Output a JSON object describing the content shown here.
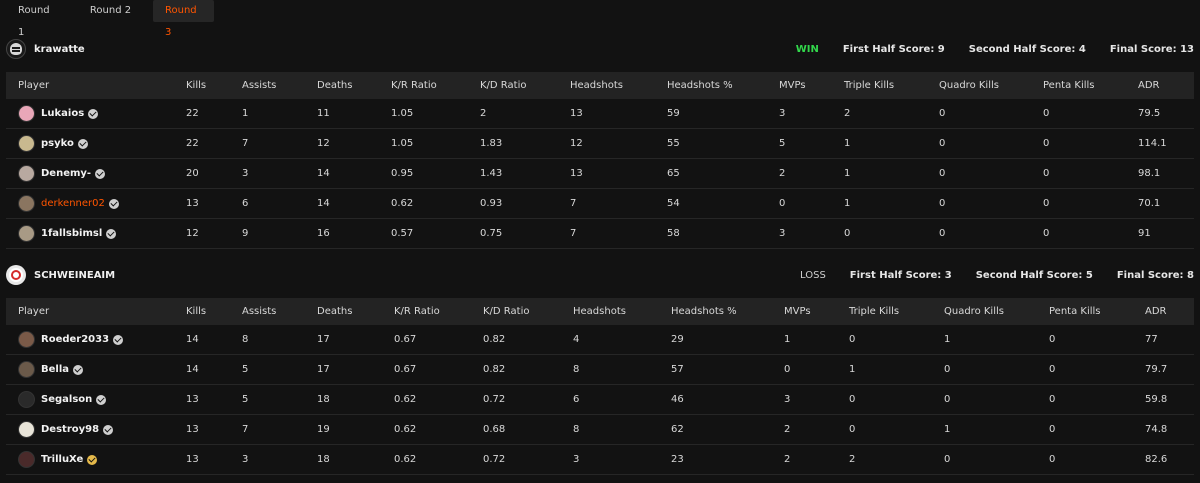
{
  "tabs": [
    {
      "label": "Round 1",
      "active": false
    },
    {
      "label": "Round 2",
      "active": false
    },
    {
      "label": "Round 3",
      "active": true
    }
  ],
  "columns": [
    "Player",
    "Kills",
    "Assists",
    "Deaths",
    "K/R Ratio",
    "K/D Ratio",
    "Headshots",
    "Headshots %",
    "MVPs",
    "Triple Kills",
    "Quadro Kills",
    "Penta Kills",
    "ADR"
  ],
  "teams": [
    {
      "name": "krawatte",
      "result": "WIN",
      "first_half": "First Half Score: 9",
      "second_half": "Second Half Score: 4",
      "final": "Final Score: 13",
      "players": [
        {
          "name": "Lukaios",
          "avatar_color": "#e9a7b8",
          "stats": [
            "22",
            "1",
            "11",
            "1.05",
            "2",
            "13",
            "59",
            "3",
            "2",
            "0",
            "0",
            "79.5"
          ]
        },
        {
          "name": "psyko",
          "avatar_color": "#c9b98f",
          "stats": [
            "22",
            "7",
            "12",
            "1.05",
            "1.83",
            "12",
            "55",
            "5",
            "1",
            "0",
            "0",
            "114.1"
          ]
        },
        {
          "name": "Denemy-",
          "avatar_color": "#b8a9a0",
          "stats": [
            "20",
            "3",
            "14",
            "0.95",
            "1.43",
            "13",
            "65",
            "2",
            "1",
            "0",
            "0",
            "98.1"
          ]
        },
        {
          "name": "derkenner02",
          "avatar_color": "#8a7560",
          "stats": [
            "13",
            "6",
            "14",
            "0.62",
            "0.93",
            "7",
            "54",
            "0",
            "1",
            "0",
            "0",
            "70.1"
          ]
        },
        {
          "name": "1fallsbimsl",
          "avatar_color": "#a89a85",
          "stats": [
            "12",
            "9",
            "16",
            "0.57",
            "0.75",
            "7",
            "58",
            "3",
            "0",
            "0",
            "0",
            "91"
          ]
        }
      ]
    },
    {
      "name": "SCHWEINEAIM",
      "result": "LOSS",
      "first_half": "First Half Score: 3",
      "second_half": "Second Half Score: 5",
      "final": "Final Score: 8",
      "players": [
        {
          "name": "Roeder2033",
          "avatar_color": "#7a5a48",
          "stats": [
            "14",
            "8",
            "17",
            "0.67",
            "0.82",
            "4",
            "29",
            "1",
            "0",
            "1",
            "0",
            "77"
          ]
        },
        {
          "name": "Bella",
          "avatar_color": "#6b5a4a",
          "stats": [
            "14",
            "5",
            "17",
            "0.67",
            "0.82",
            "8",
            "57",
            "0",
            "1",
            "0",
            "0",
            "79.7"
          ]
        },
        {
          "name": "Segalson",
          "avatar_color": "#2a2a2a",
          "stats": [
            "13",
            "5",
            "18",
            "0.62",
            "0.72",
            "6",
            "46",
            "3",
            "0",
            "0",
            "0",
            "59.8"
          ]
        },
        {
          "name": "Destroy98",
          "avatar_color": "#e8e4d8",
          "stats": [
            "13",
            "7",
            "19",
            "0.62",
            "0.68",
            "8",
            "62",
            "2",
            "0",
            "1",
            "0",
            "74.8"
          ]
        },
        {
          "name": "TrilluXe",
          "avatar_color": "#4a2a2a",
          "stats": [
            "13",
            "3",
            "18",
            "0.62",
            "0.72",
            "3",
            "23",
            "2",
            "2",
            "0",
            "0",
            "82.6"
          ]
        }
      ]
    }
  ],
  "colors": {
    "accent": "#ff5500",
    "win": "#32d74b",
    "background": "#121212"
  }
}
